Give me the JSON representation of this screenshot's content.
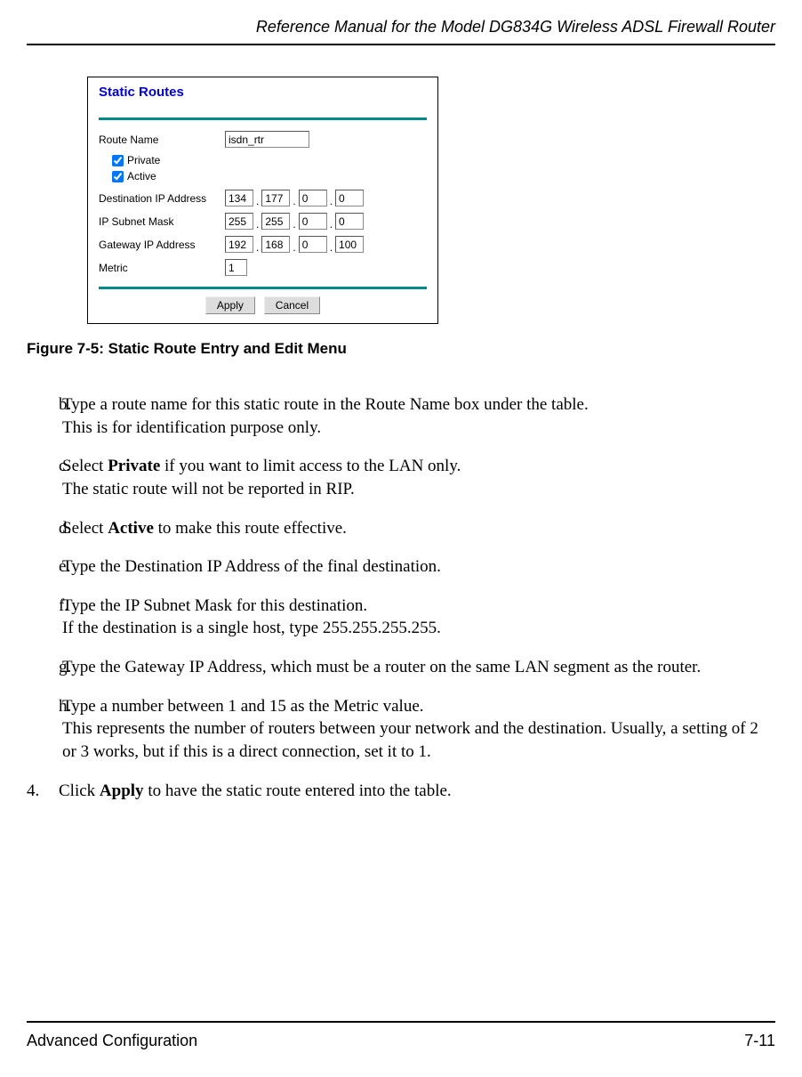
{
  "header": {
    "title": "Reference Manual for the Model DG834G Wireless ADSL Firewall Router"
  },
  "screenshot": {
    "title": "Static Routes",
    "routeName": {
      "label": "Route Name",
      "value": "isdn_rtr"
    },
    "private": {
      "label": "Private",
      "checked": true
    },
    "active": {
      "label": "Active",
      "checked": true
    },
    "destIp": {
      "label": "Destination IP Address",
      "octets": [
        "134",
        "177",
        "0",
        "0"
      ]
    },
    "subnet": {
      "label": "IP Subnet Mask",
      "octets": [
        "255",
        "255",
        "0",
        "0"
      ]
    },
    "gateway": {
      "label": "Gateway IP Address",
      "octets": [
        "192",
        "168",
        "0",
        "100"
      ]
    },
    "metric": {
      "label": "Metric",
      "value": "1"
    },
    "buttons": {
      "apply": "Apply",
      "cancel": "Cancel"
    }
  },
  "figureCaption": "Figure 7-5:  Static Route Entry and Edit Menu",
  "steps": {
    "b": {
      "marker": "b.",
      "line1": "Type a route name for this static route in the Route Name box under the table.",
      "line2": "This is for identification purpose only."
    },
    "c": {
      "marker": "c.",
      "prefix": "Select ",
      "bold": "Private",
      "suffix": " if you want to limit access to the LAN only.",
      "line2": "The static route will not be reported in RIP."
    },
    "d": {
      "marker": "d.",
      "prefix": "Select ",
      "bold": "Active",
      "suffix": " to make this route effective."
    },
    "e": {
      "marker": "e.",
      "text": "Type the Destination IP Address of the final destination."
    },
    "f": {
      "marker": "f.",
      "line1": "Type the IP Subnet Mask for this destination.",
      "line2": "If the destination is a single host, type 255.255.255.255."
    },
    "g": {
      "marker": "g.",
      "text": "Type the Gateway IP Address, which must be a router on the same LAN segment as the router."
    },
    "h": {
      "marker": "h.",
      "line1": "Type a number between 1 and 15 as the Metric value.",
      "line2": "This represents the number of routers between your network and the destination. Usually, a setting of 2 or 3 works, but if this is a direct connection, set it to 1."
    },
    "step4": {
      "marker": "4.",
      "prefix": "Click ",
      "bold": "Apply",
      "suffix": " to have the static route entered into the table."
    }
  },
  "footer": {
    "left": "Advanced Configuration",
    "right": "7-11"
  }
}
